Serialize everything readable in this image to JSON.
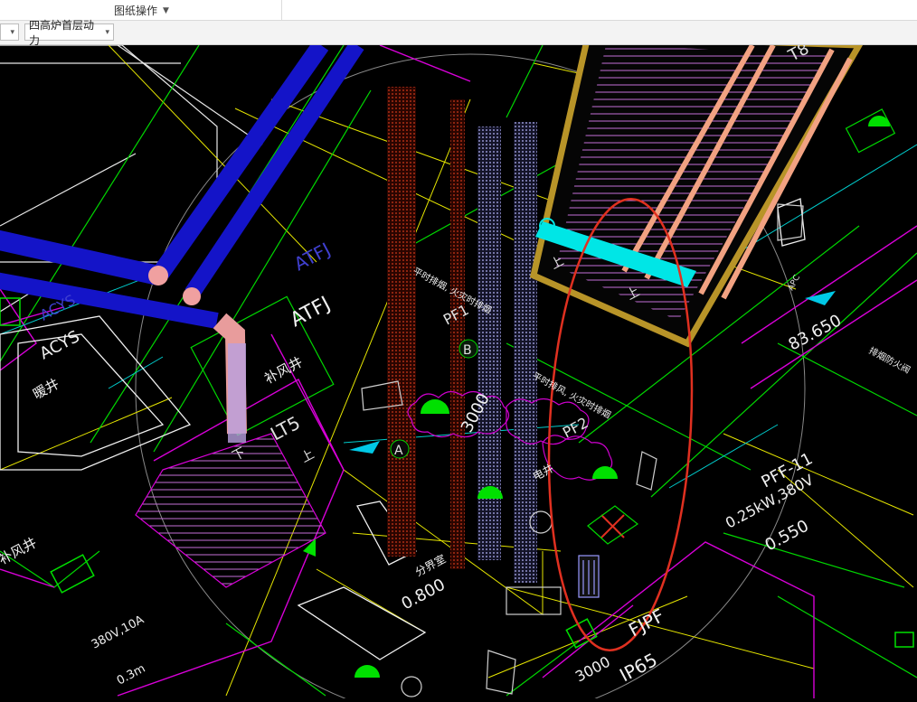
{
  "menubar": {
    "drawing_ops_label": "图纸操作"
  },
  "toolbar": {
    "floor_select_value": "四高炉首层动力"
  },
  "labels": {
    "atfj_top": "ATFJ",
    "atfj": "ATFJ",
    "acys_top": "ACYS",
    "acys": "ACYS",
    "nuanjing": "暖井",
    "bufengjing": "补风井",
    "bufengjing_left": "补风井",
    "lt5": "LT5",
    "down": "下",
    "up": "上",
    "up_escalator_1": "上",
    "up_escalator_2": "上",
    "pf1": "PF1",
    "pf2": "PF2",
    "marker_b": "B",
    "marker_a": "A",
    "dim_3000_mid": "3000",
    "dim_3000_bottom": "3000",
    "elev_83650": "83.650",
    "elev_0550": "0.550",
    "elev_0800": "0.800",
    "pff11": "PFF-11",
    "power_spec": "0.25kW,380V",
    "ip65": "IP65",
    "fjpf": "FJPF",
    "fenjieshi": "分界室",
    "dianjing": "电井",
    "power_380": "380V,10A",
    "dim_03m": "0.3m",
    "note_pf1": "平时排烟, 火灾时排烟",
    "note_pf2": "平时排风, 火灾时排烟",
    "note_right": "排烟防火阀",
    "t8": "T8",
    "apc": "APC"
  },
  "colors": {
    "duct_blue": "#1414c8",
    "duct_elbow": "#f0a0a0",
    "highlight_red": "#e03020",
    "cad_yellow": "#e6e600",
    "cad_green": "#00e000",
    "cad_magenta": "#e000e0",
    "cad_cyan": "#00e6e6",
    "escalator_gold": "#b89428",
    "escalator_salmon": "#f2a282"
  }
}
